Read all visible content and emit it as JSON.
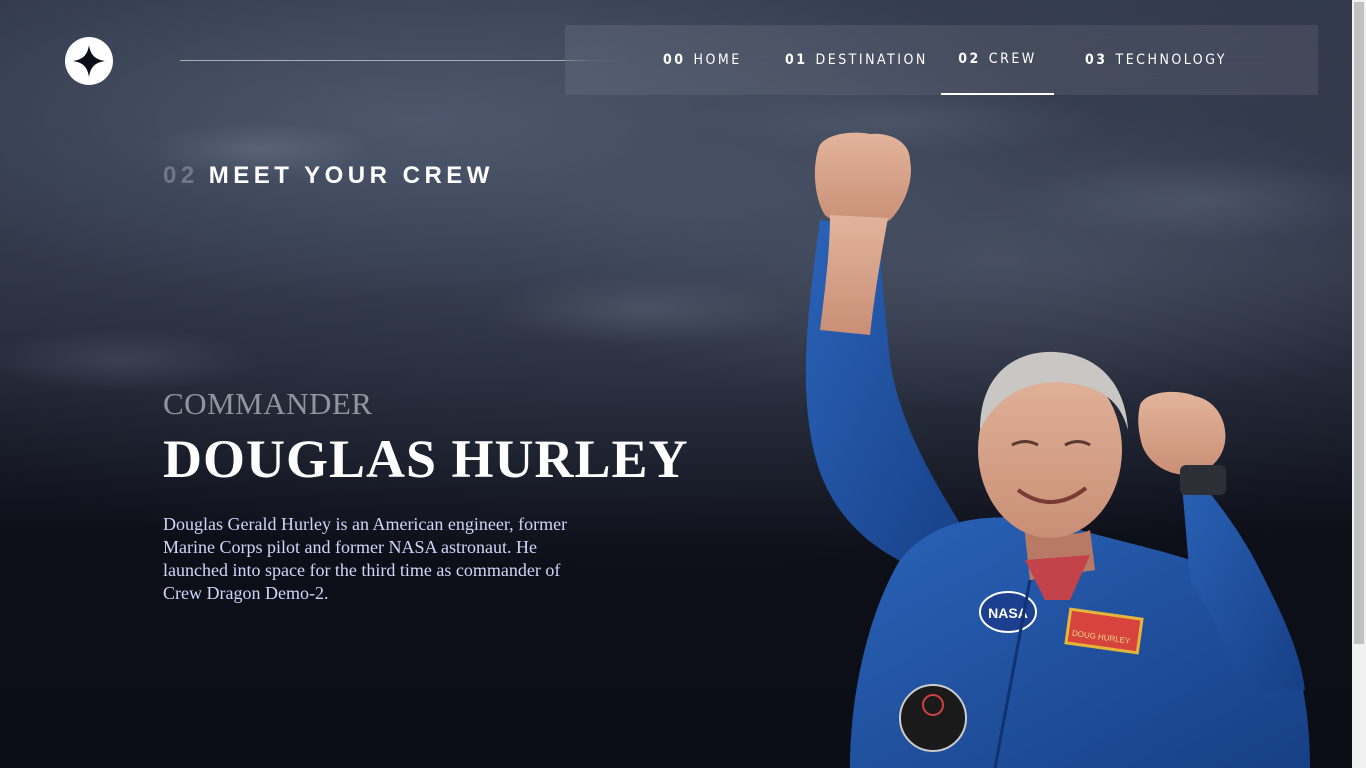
{
  "colors": {
    "background": "#0b0d17",
    "text": "#ffffff",
    "bio_text": "#d0d6f9",
    "suit_blue": "#1f4fa0"
  },
  "header": {
    "logo_icon": "star-logo-icon",
    "nav": [
      {
        "num": "00",
        "label": "HOME",
        "active": false
      },
      {
        "num": "01",
        "label": "DESTINATION",
        "active": false
      },
      {
        "num": "02",
        "label": "CREW",
        "active": true
      },
      {
        "num": "03",
        "label": "TECHNOLOGY",
        "active": false
      }
    ]
  },
  "main": {
    "section_num": "02",
    "section_title": "MEET YOUR CREW",
    "crew_member": {
      "role": "COMMANDER",
      "name": "DOUGLAS HURLEY",
      "bio": "Douglas Gerald Hurley is an American engineer, former Marine Corps pilot and former NASA astronaut. He launched into space for the third time as commander of Crew Dragon Demo-2.",
      "image_icon": "astronaut-portrait-image",
      "patch_nasa": "NASA",
      "patch_name": "DOUG HURLEY"
    }
  }
}
